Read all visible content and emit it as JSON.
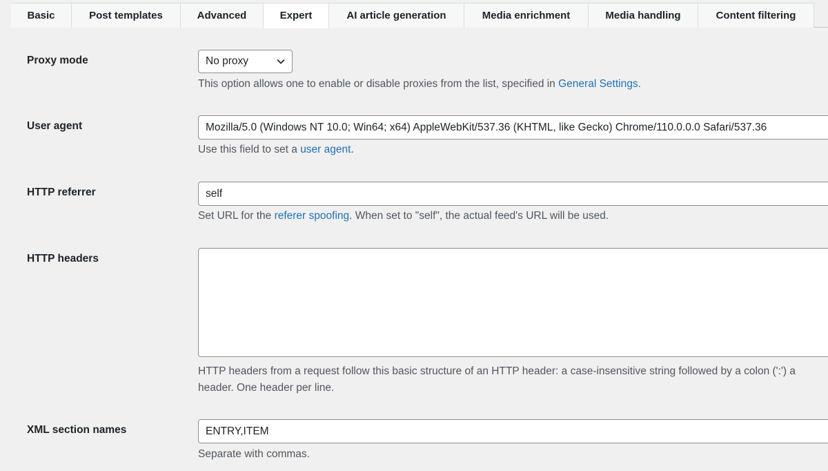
{
  "tabs": [
    {
      "label": "Basic",
      "active": false
    },
    {
      "label": "Post templates",
      "active": false
    },
    {
      "label": "Advanced",
      "active": false
    },
    {
      "label": "Expert",
      "active": true
    },
    {
      "label": "AI article generation",
      "active": false
    },
    {
      "label": "Media enrichment",
      "active": false
    },
    {
      "label": "Media handling",
      "active": false
    },
    {
      "label": "Content filtering",
      "active": false
    }
  ],
  "proxy_mode": {
    "label": "Proxy mode",
    "selected": "No proxy",
    "desc_before": "This option allows one to enable or disable proxies from the list, specified in ",
    "desc_link": "General Settings",
    "desc_after": "."
  },
  "user_agent": {
    "label": "User agent",
    "value": "Mozilla/5.0 (Windows NT 10.0; Win64; x64) AppleWebKit/537.36 (KHTML, like Gecko) Chrome/110.0.0.0 Safari/537.36",
    "desc_before": "Use this field to set a ",
    "desc_link": "user agent",
    "desc_after": "."
  },
  "http_referrer": {
    "label": "HTTP referrer",
    "value": "self",
    "desc_before": "Set URL for the ",
    "desc_link": "referer spoofing",
    "desc_after": ". When set to \"self\", the actual feed's URL will be used."
  },
  "http_headers": {
    "label": "HTTP headers",
    "value": "",
    "desc_line1": "HTTP headers from a request follow this basic structure of an HTTP header: a case-insensitive string followed by a colon (':') a",
    "desc_line2": "header. One header per line."
  },
  "xml_section_names": {
    "label": "XML section names",
    "value": "ENTRY,ITEM",
    "desc": "Separate with commas."
  },
  "colors": {
    "background": "#f0f0f1",
    "link": "#2271b1",
    "text": "#1d2327",
    "description": "#50575e"
  }
}
